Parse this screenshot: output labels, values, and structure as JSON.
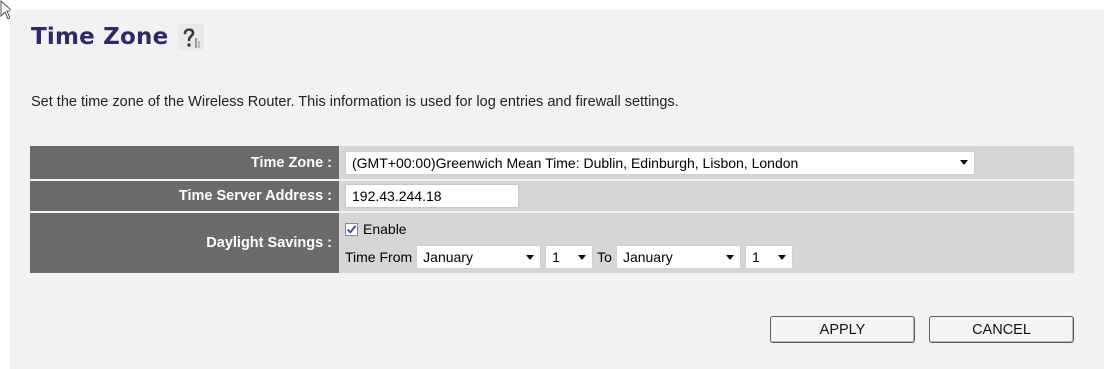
{
  "header": {
    "title": "Time Zone",
    "description": "Set the time zone of the Wireless Router. This information is used for log entries and firewall settings."
  },
  "form": {
    "time_zone": {
      "label": "Time Zone :",
      "value": "(GMT+00:00)Greenwich Mean Time: Dublin, Edinburgh, Lisbon, London"
    },
    "time_server": {
      "label": "Time Server Address :",
      "value": "192.43.244.18"
    },
    "daylight_savings": {
      "label": "Daylight Savings :",
      "enable_label": "Enable",
      "enabled": true,
      "from_label": "Time From",
      "to_label": "To",
      "from_month": "January",
      "from_day": "1",
      "to_month": "January",
      "to_day": "1"
    }
  },
  "buttons": {
    "apply": "APPLY",
    "cancel": "CANCEL"
  },
  "colors": {
    "label_bg": "#6b6b6b",
    "value_bg": "#d6d6d6",
    "title": "#2e2a6a"
  },
  "icons": [
    "mouse-cursor-icon",
    "help-icon",
    "checkmark-icon",
    "dropdown-arrow-icon"
  ]
}
